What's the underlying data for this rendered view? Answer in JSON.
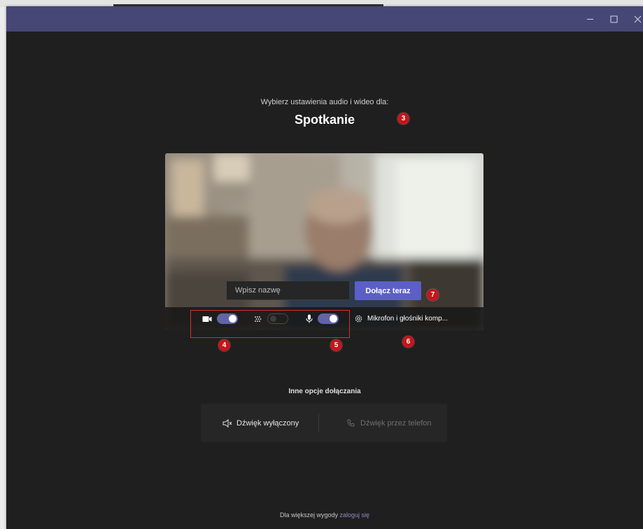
{
  "window": {
    "controls": [
      {
        "name": "minimize-button",
        "icon": "minimize-icon"
      },
      {
        "name": "maximize-button",
        "icon": "maximize-icon"
      },
      {
        "name": "close-button",
        "icon": "close-icon"
      }
    ],
    "titlebar_color": "#464775"
  },
  "header": {
    "subtitle": "Wybierz ustawienia audio i wideo dla:",
    "title": "Spotkanie"
  },
  "preview": {
    "name_placeholder": "Wpisz nazwę",
    "name_value": "",
    "join_label": "Dołącz teraz",
    "camera": {
      "icon": "video-camera-icon",
      "on": true
    },
    "background_blur": {
      "icon": "blur-background-icon",
      "on": false
    },
    "microphone": {
      "icon": "microphone-icon",
      "on": true
    },
    "device_settings": {
      "icon": "gear-icon",
      "label": "Mikrofon i głośniki komp..."
    }
  },
  "badges": {
    "b3": "3",
    "b4": "4",
    "b5": "5",
    "b6": "6",
    "b7": "7"
  },
  "other_options": {
    "heading": "Inne opcje dołączania",
    "audio_off": {
      "icon": "speaker-off-icon",
      "label": "Dźwięk wyłączony"
    },
    "phone_audio": {
      "icon": "phone-icon",
      "label": "Dźwięk przez telefon"
    }
  },
  "footer": {
    "text": "Dla większej wygody",
    "link": "zaloguj się"
  },
  "colors": {
    "accent": "#5b5fc7",
    "badge": "#c4161c",
    "highlight": "#d32f2f",
    "background": "#1f1f1f"
  }
}
